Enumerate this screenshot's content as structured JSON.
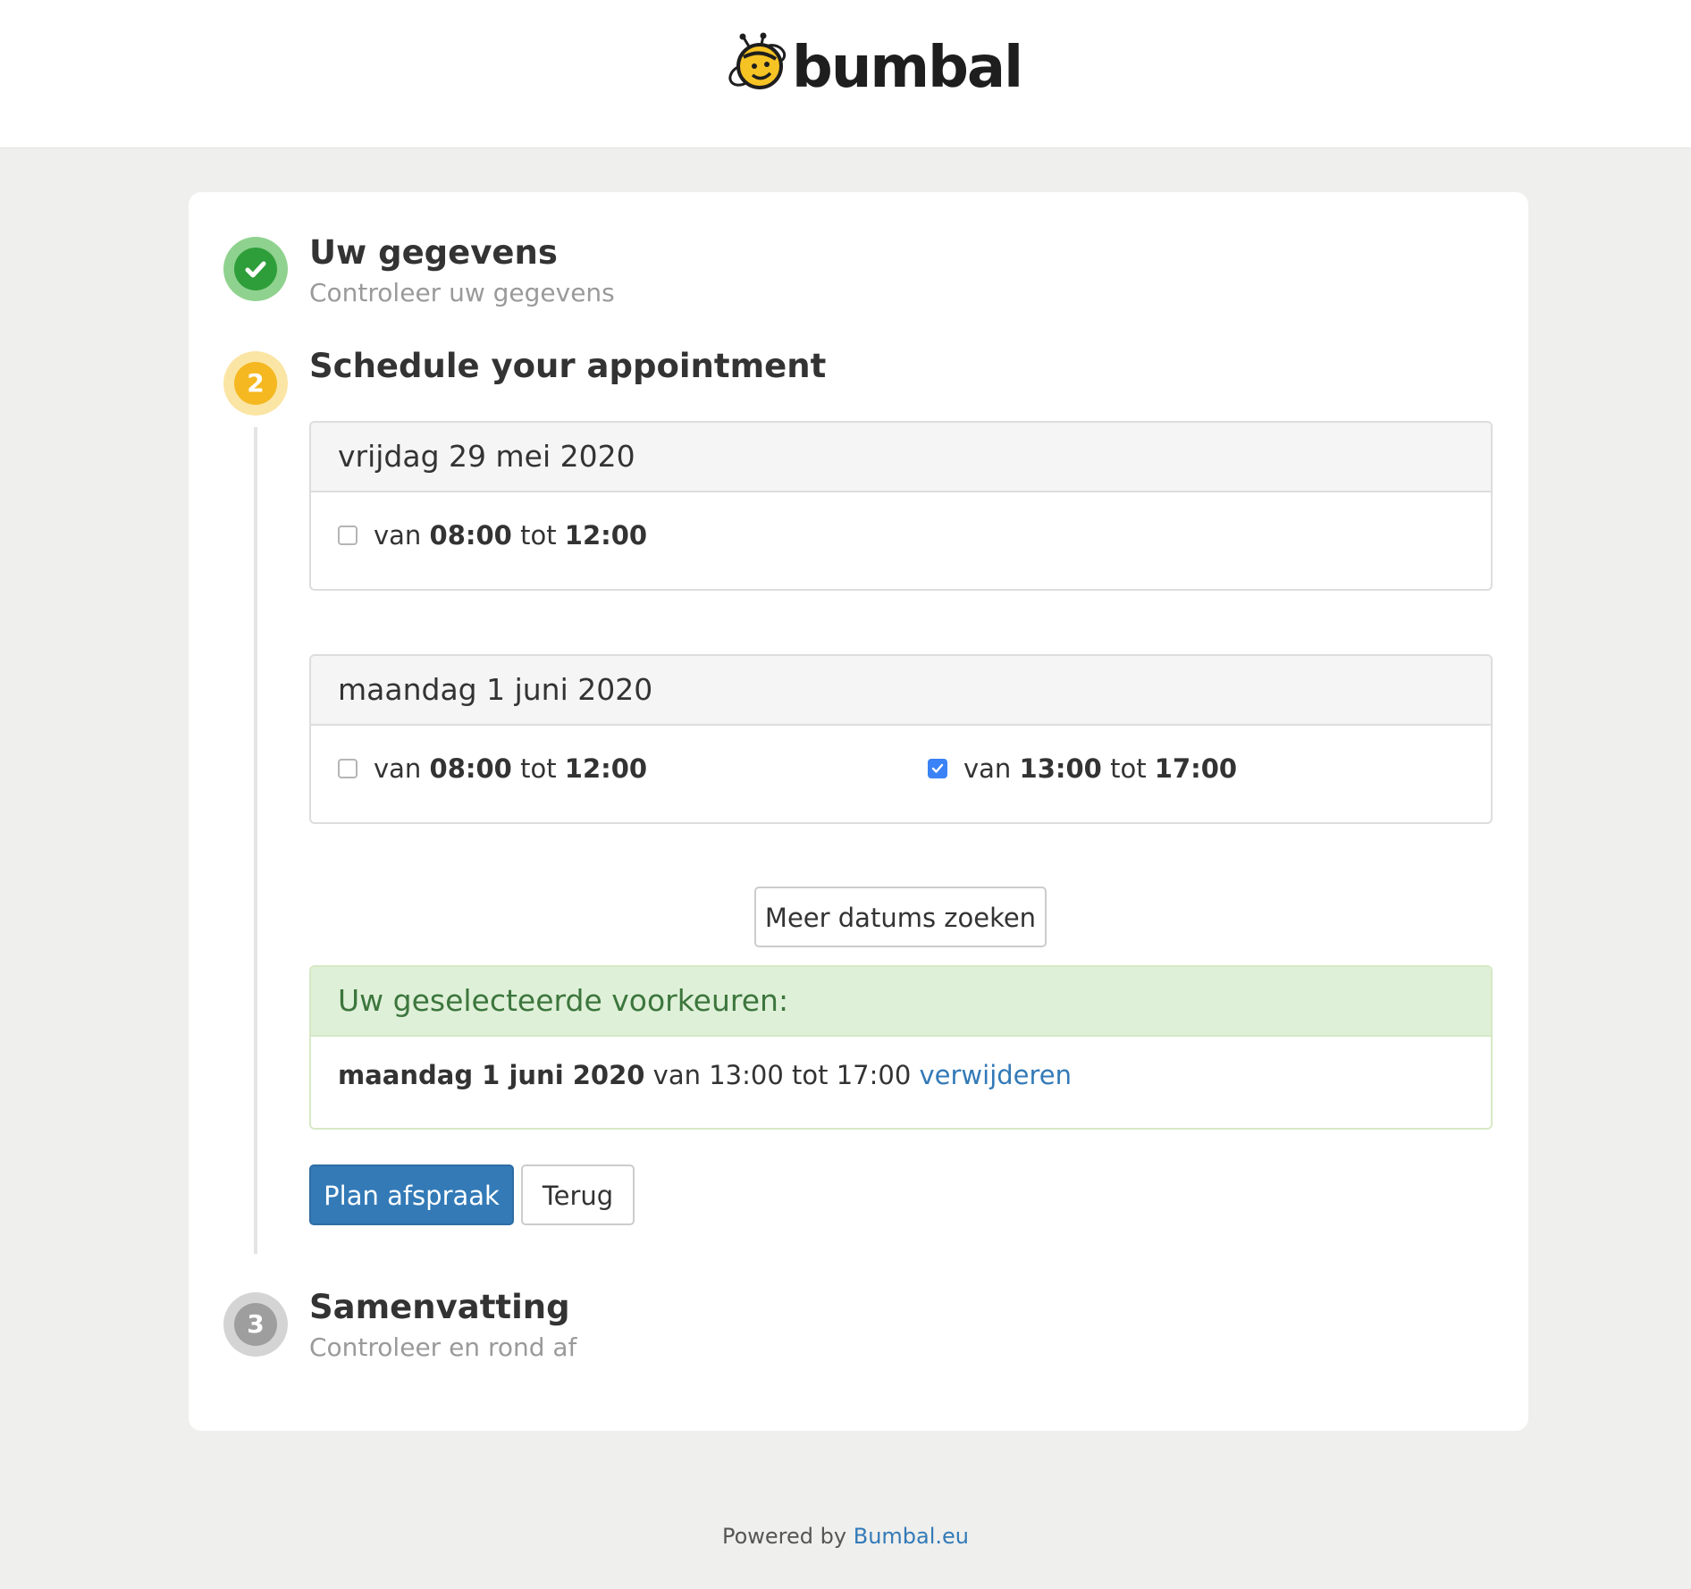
{
  "header": {
    "logo_text": "bumbal",
    "logo_icon": "bee-icon"
  },
  "steps": [
    {
      "number": "1",
      "title": "Uw gegevens",
      "subtitle": "Controleer uw gegevens",
      "state": "done",
      "color": "#2e9e3a"
    },
    {
      "number": "2",
      "title": "Schedule your appointment",
      "state": "active",
      "color": "#f5b820"
    },
    {
      "number": "3",
      "title": "Samenvatting",
      "subtitle": "Controleer en rond af",
      "state": "pending",
      "color": "#9e9e9e"
    }
  ],
  "days": [
    {
      "date": "vrijdag 29 mei 2020",
      "slots": [
        {
          "prefix": "van",
          "from": "08:00",
          "mid": "tot",
          "to": "12:00",
          "checked": false
        }
      ]
    },
    {
      "date": "maandag 1 juni 2020",
      "slots": [
        {
          "prefix": "van",
          "from": "08:00",
          "mid": "tot",
          "to": "12:00",
          "checked": false
        },
        {
          "prefix": "van",
          "from": "13:00",
          "mid": "tot",
          "to": "17:00",
          "checked": true
        }
      ]
    }
  ],
  "more_dates_button": "Meer datums zoeken",
  "preferences": {
    "title": "Uw geselecteerde voorkeuren:",
    "items": [
      {
        "date": "maandag 1 juni 2020",
        "time": "van 13:00 tot 17:00",
        "remove_label": "verwijderen"
      }
    ]
  },
  "actions": {
    "primary": "Plan afspraak",
    "secondary": "Terug"
  },
  "footer": {
    "text": "Powered by",
    "link": "Bumbal.eu"
  },
  "colors": {
    "accent": "#337ab7",
    "success": "#3c763d",
    "checkbox": "#3b82f6"
  }
}
